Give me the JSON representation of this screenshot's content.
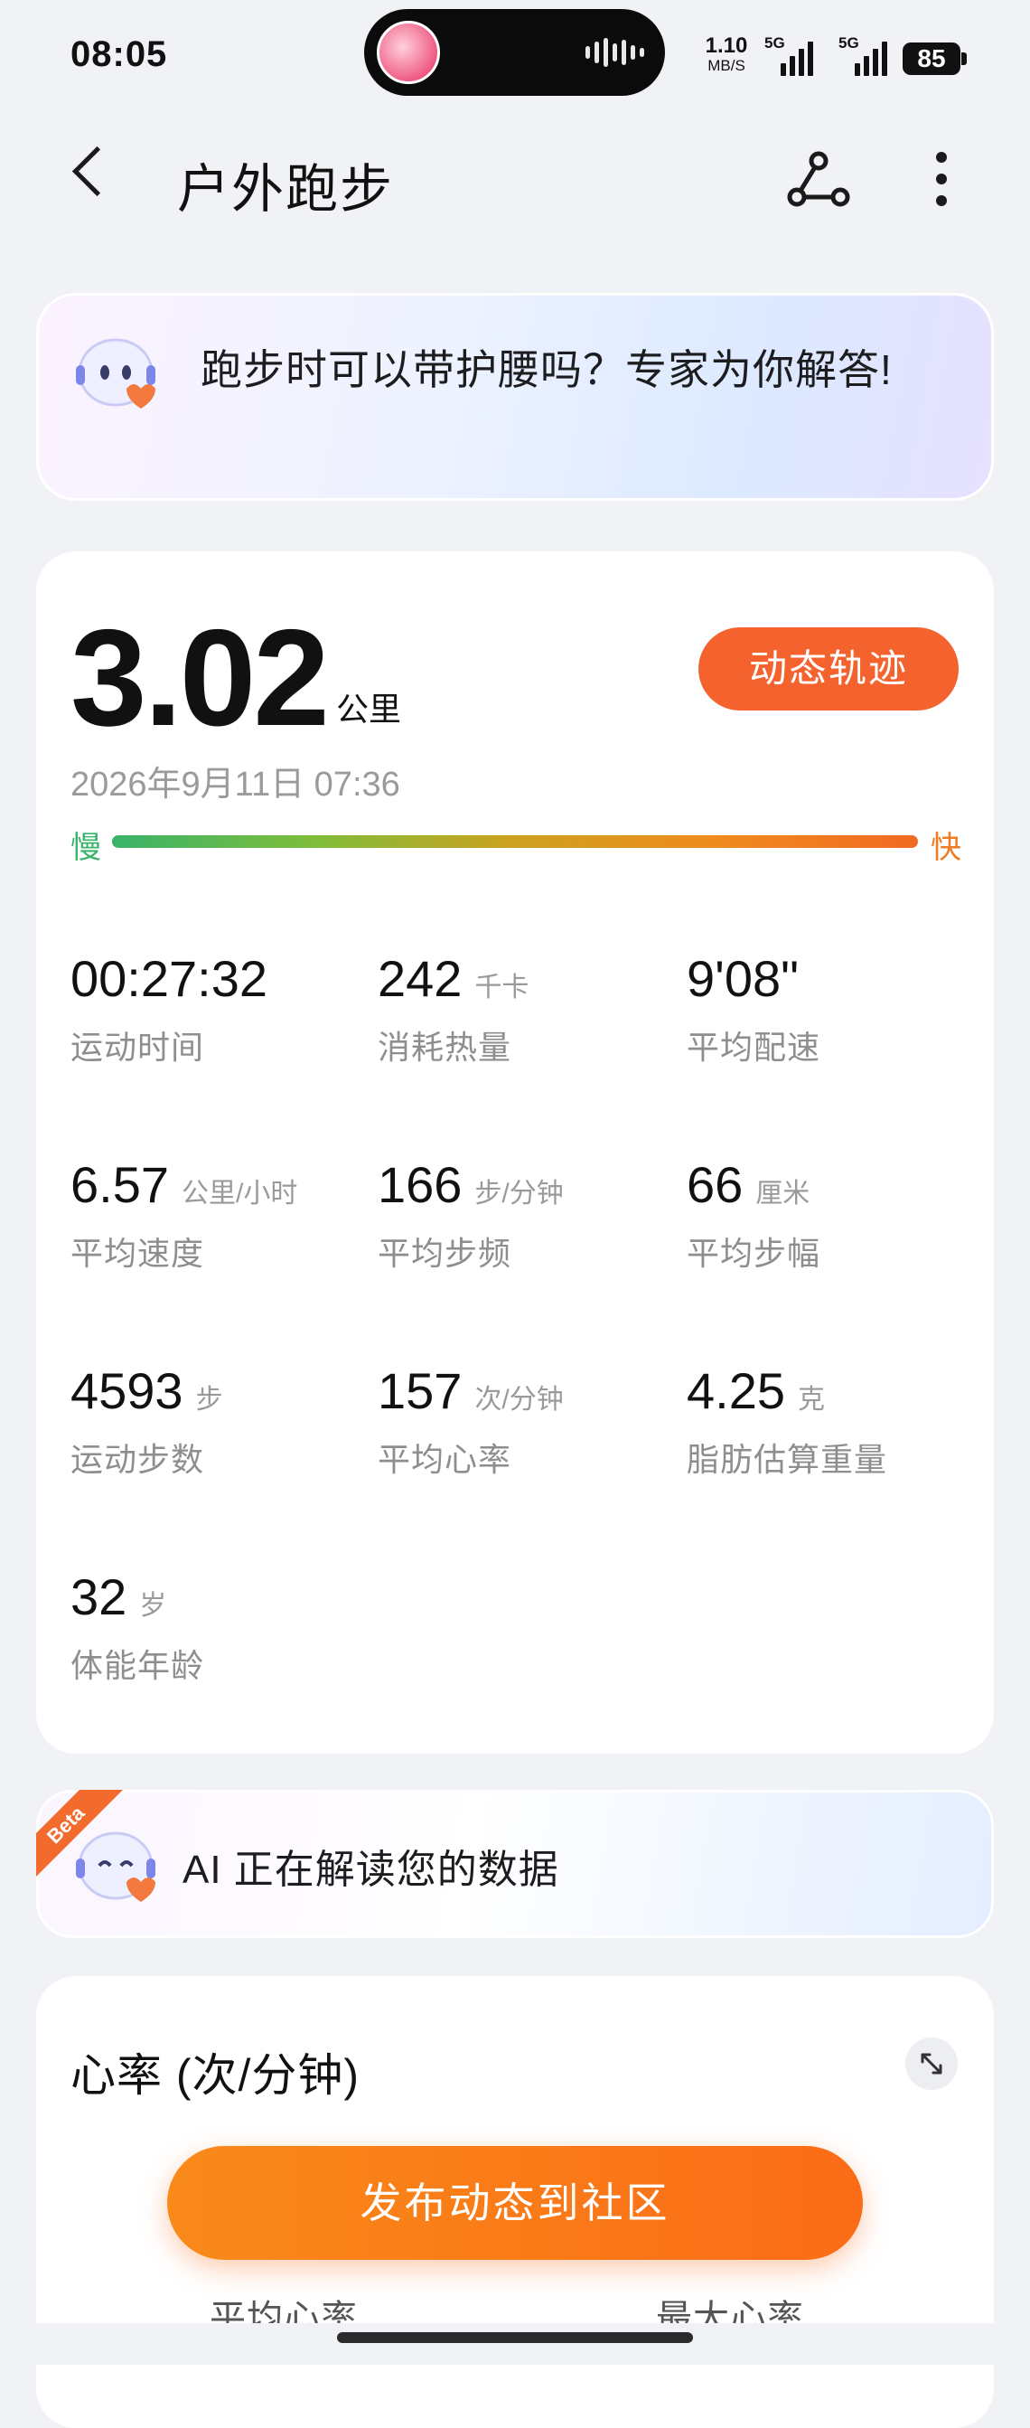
{
  "status_bar": {
    "time": "08:05",
    "net_speed": "1.10",
    "net_speed_unit": "MB/S",
    "sim1": "5G",
    "sim2": "5G",
    "battery": "85"
  },
  "header": {
    "title": "户外跑步",
    "back_icon": "chevron-left-icon",
    "route_icon": "route-share-icon",
    "more_icon": "more-vertical-icon"
  },
  "banner": {
    "text": "跑步时可以带护腰吗？专家为你解答!"
  },
  "summary": {
    "distance": "3.02",
    "distance_unit": "公里",
    "track_button": "动态轨迹",
    "datetime": "2026年9月11日 07:36",
    "pace_slow_label": "慢",
    "pace_fast_label": "快"
  },
  "metrics": [
    {
      "value": "00:27:32",
      "unit": "",
      "label": "运动时间"
    },
    {
      "value": "242",
      "unit": "千卡",
      "label": "消耗热量"
    },
    {
      "value": "9'08\"",
      "unit": "",
      "label": "平均配速"
    },
    {
      "value": "6.57",
      "unit": "公里/小时",
      "label": "平均速度"
    },
    {
      "value": "166",
      "unit": "步/分钟",
      "label": "平均步频"
    },
    {
      "value": "66",
      "unit": "厘米",
      "label": "平均步幅"
    },
    {
      "value": "4593",
      "unit": "步",
      "label": "运动步数"
    },
    {
      "value": "157",
      "unit": "次/分钟",
      "label": "平均心率"
    },
    {
      "value": "4.25",
      "unit": "克",
      "label": "脂肪估算重量"
    },
    {
      "value": "32",
      "unit": "岁",
      "label": "体能年龄"
    }
  ],
  "ai_card": {
    "badge": "Beta",
    "text": "AI 正在解读您的数据"
  },
  "heart_rate": {
    "title": "心率 (次/分钟)",
    "avg_label": "平均心率",
    "max_label": "最大心率"
  },
  "publish_button": "发布动态到社区",
  "colors": {
    "accent_orange": "#f4622e",
    "publish_orange": "#fb7a18",
    "pace_slow": "#39b36a",
    "pace_fast": "#f26a22"
  }
}
